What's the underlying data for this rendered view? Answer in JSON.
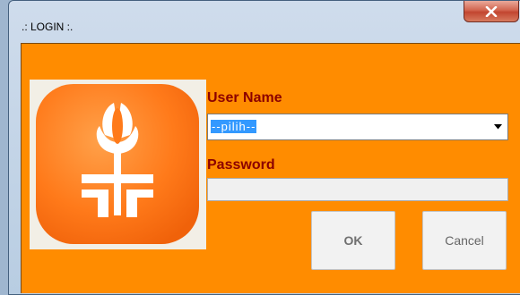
{
  "window": {
    "title": ".: LOGIN :."
  },
  "icons": {
    "close": "close-icon",
    "logo": "tulip-logo",
    "dropdown": "chevron-down-icon"
  },
  "colors": {
    "form_background": "#ff8c00",
    "label_text": "#8b0000",
    "selection_highlight": "#3399ff"
  },
  "form": {
    "username_label": "User Name",
    "username_value": "--pilih--",
    "password_label": "Password",
    "password_value": ""
  },
  "buttons": {
    "ok_label": "OK",
    "cancel_label": "Cancel"
  }
}
